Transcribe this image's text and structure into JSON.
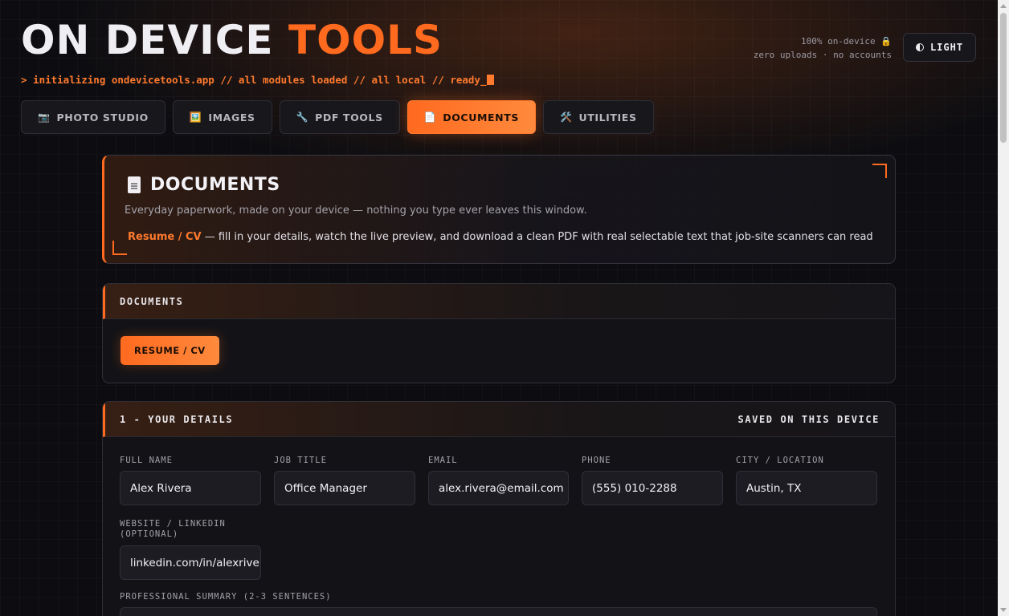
{
  "brand": {
    "word1": "ON DEVICE",
    "word2": "TOOLS"
  },
  "ticker": "> initializing ondevicetools.app // all modules loaded // all local // ready_",
  "status": {
    "line1": "100% on-device 🔒",
    "line2": "zero uploads · no accounts"
  },
  "theme_toggle": {
    "label": "LIGHT",
    "icon": "contrast-icon"
  },
  "tabs": [
    {
      "label": "PHOTO STUDIO",
      "icon": "📷",
      "active": false
    },
    {
      "label": "IMAGES",
      "icon": "🖼️",
      "active": false
    },
    {
      "label": "PDF TOOLS",
      "icon": "🔧",
      "active": false
    },
    {
      "label": "DOCUMENTS",
      "icon": "📄",
      "active": true
    },
    {
      "label": "UTILITIES",
      "icon": "🛠️",
      "active": false
    }
  ],
  "hero": {
    "title": "DOCUMENTS",
    "subtitle": "Everyday paperwork, made on your device — nothing you type ever leaves this window.",
    "feature_name": "Resume / CV",
    "feature_desc": " — fill in your details, watch the live preview, and download a clean PDF with real selectable text that job-site scanners can read"
  },
  "documents_panel": {
    "title": "DOCUMENTS",
    "button": "RESUME / CV"
  },
  "details_panel": {
    "title": "1 - YOUR DETAILS",
    "status": "SAVED ON THIS DEVICE",
    "fields": {
      "full_name": {
        "label": "FULL NAME",
        "value": "Alex Rivera"
      },
      "job_title": {
        "label": "JOB TITLE",
        "value": "Office Manager"
      },
      "email": {
        "label": "EMAIL",
        "value": "alex.rivera@email.com"
      },
      "phone": {
        "label": "PHONE",
        "value": "(555) 010-2288"
      },
      "city": {
        "label": "CITY / LOCATION",
        "value": "Austin, TX"
      },
      "website": {
        "label_line1": "WEBSITE / LINKEDIN",
        "label_line2": "(OPTIONAL)",
        "value": "linkedin.com/in/alexrivera"
      },
      "summary": {
        "label": "PROFESSIONAL SUMMARY (2-3 SENTENCES)"
      }
    }
  },
  "colors": {
    "accent": "#ff6a1f",
    "background": "#0d0d11",
    "panel": "#131317"
  }
}
